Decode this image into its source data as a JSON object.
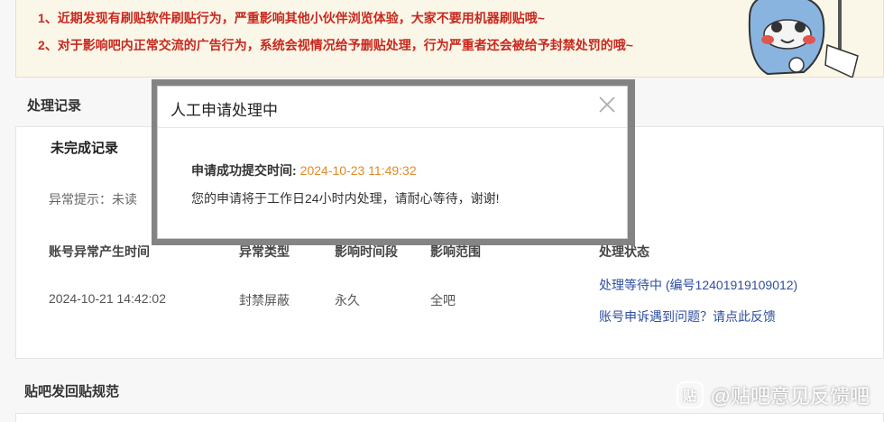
{
  "notice": {
    "line1": "1、近期发现有刷贴软件刷贴行为，严重影响其他小伙伴浏览体验，大家不要用机器刷贴哦~",
    "line2": "2、对于影响吧内正常交流的广告行为，系统会视情况给予删贴处理，行为严重者还会被给予封禁处罚的哦~"
  },
  "records": {
    "section_title": "处理记录",
    "sub_title": "未完成记录",
    "hint": "异常提示：未读",
    "headers": [
      "账号异常产生时间",
      "异常类型",
      "影响时间段",
      "影响范围",
      "处理状态"
    ],
    "row": {
      "time": "2024-10-21 14:42:02",
      "type": "封禁屏蔽",
      "period": "永久",
      "scope": "全吧",
      "status": "处理等待中 (编号12401919109012)",
      "feedback": "账号申诉遇到问题？请点此反馈"
    }
  },
  "rules_title": "贴吧发回贴规范",
  "dialog": {
    "title": "人工申请处理中",
    "submit_label": "申请成功提交时间:",
    "submit_time": "2024-10-23 11:49:32",
    "message": "您的申请将于工作日24小时内处理，请耐心等待，谢谢!"
  },
  "watermark": {
    "logo_glyph": "贴",
    "text": "@贴吧意见反馈吧"
  },
  "colors": {
    "notice_red": "#c8281e",
    "link_blue": "#2e4e9e",
    "time_orange": "#e08a2a"
  }
}
